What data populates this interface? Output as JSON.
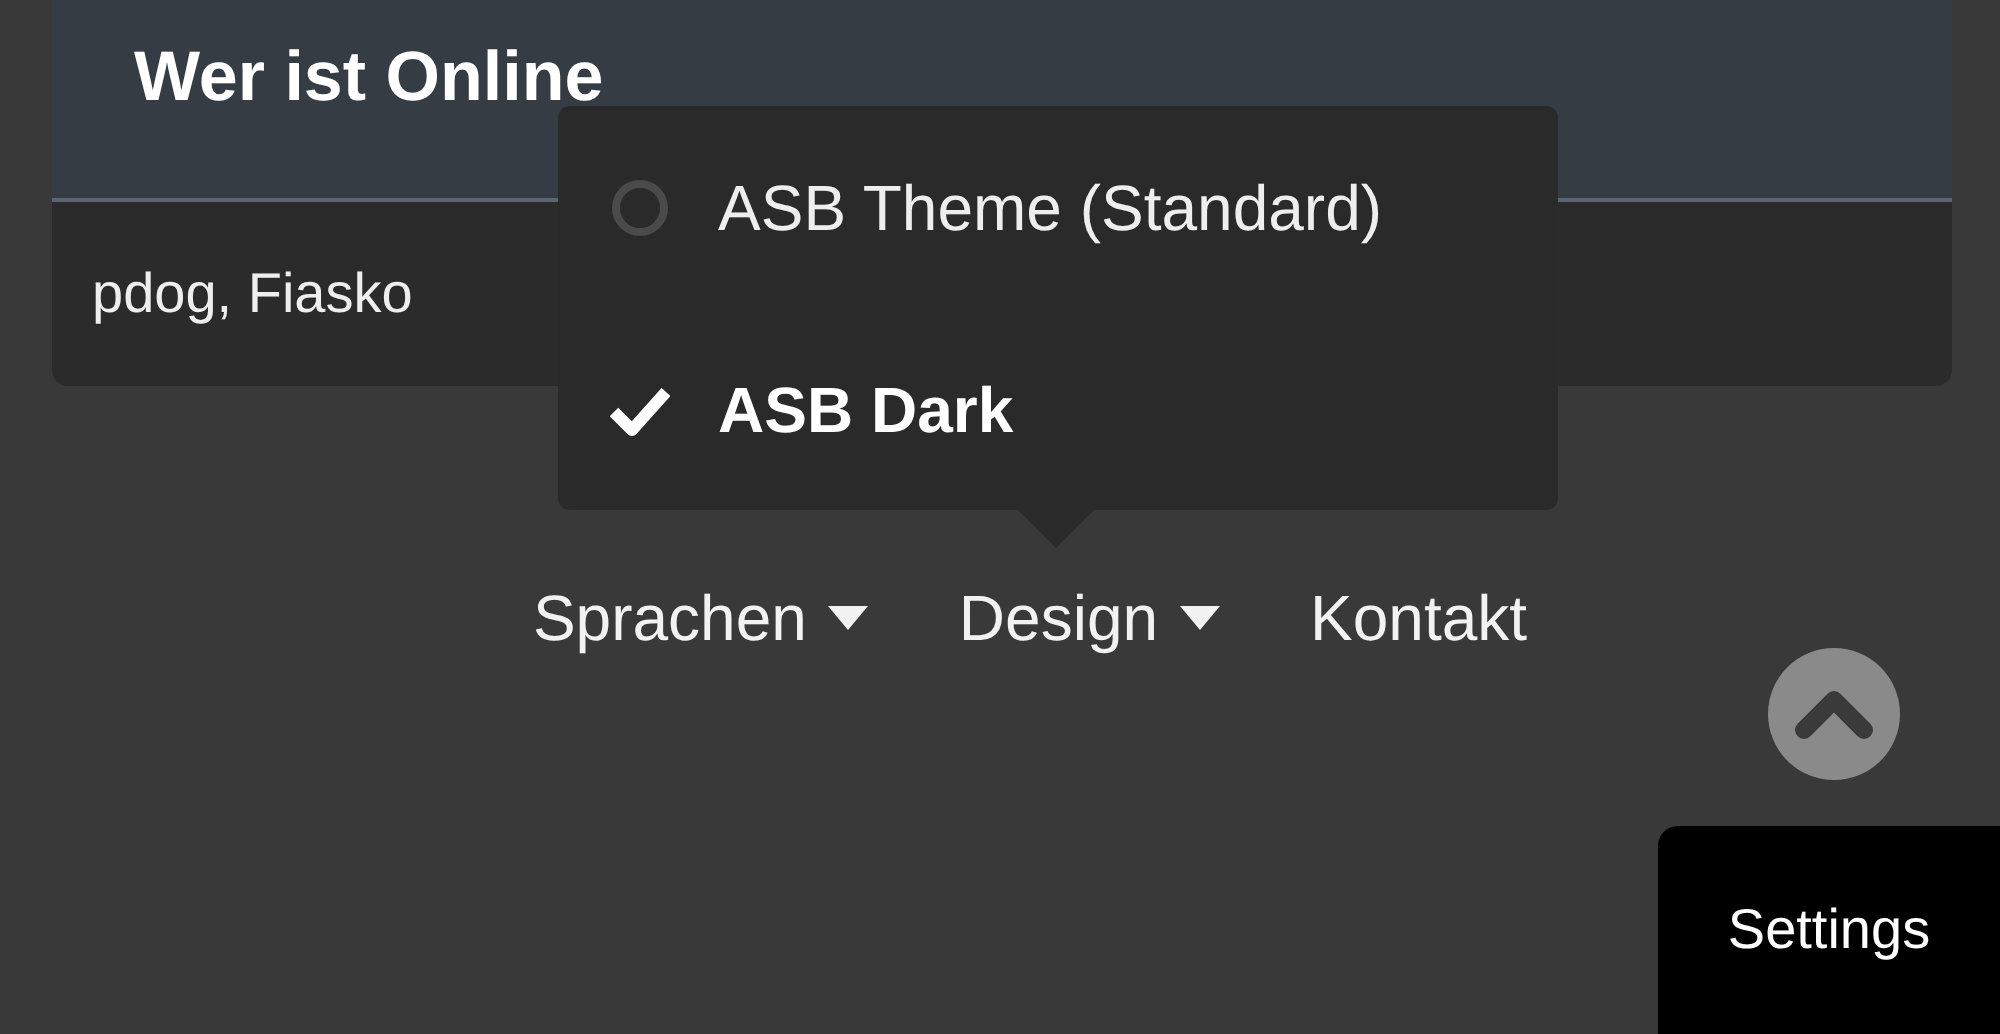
{
  "online_card": {
    "title": "Wer ist Online",
    "users": "pdog, Fiasko"
  },
  "design_menu": {
    "items": [
      {
        "label": "ASB Theme (Standard)",
        "selected": false
      },
      {
        "label": "ASB Dark",
        "selected": true
      }
    ]
  },
  "footer_nav": [
    {
      "label": "Sprachen",
      "kind": "dropdown"
    },
    {
      "label": "Design",
      "kind": "dropdown"
    },
    {
      "label": "Kontakt",
      "kind": "link"
    }
  ],
  "settings_button": {
    "label": "Settings"
  }
}
